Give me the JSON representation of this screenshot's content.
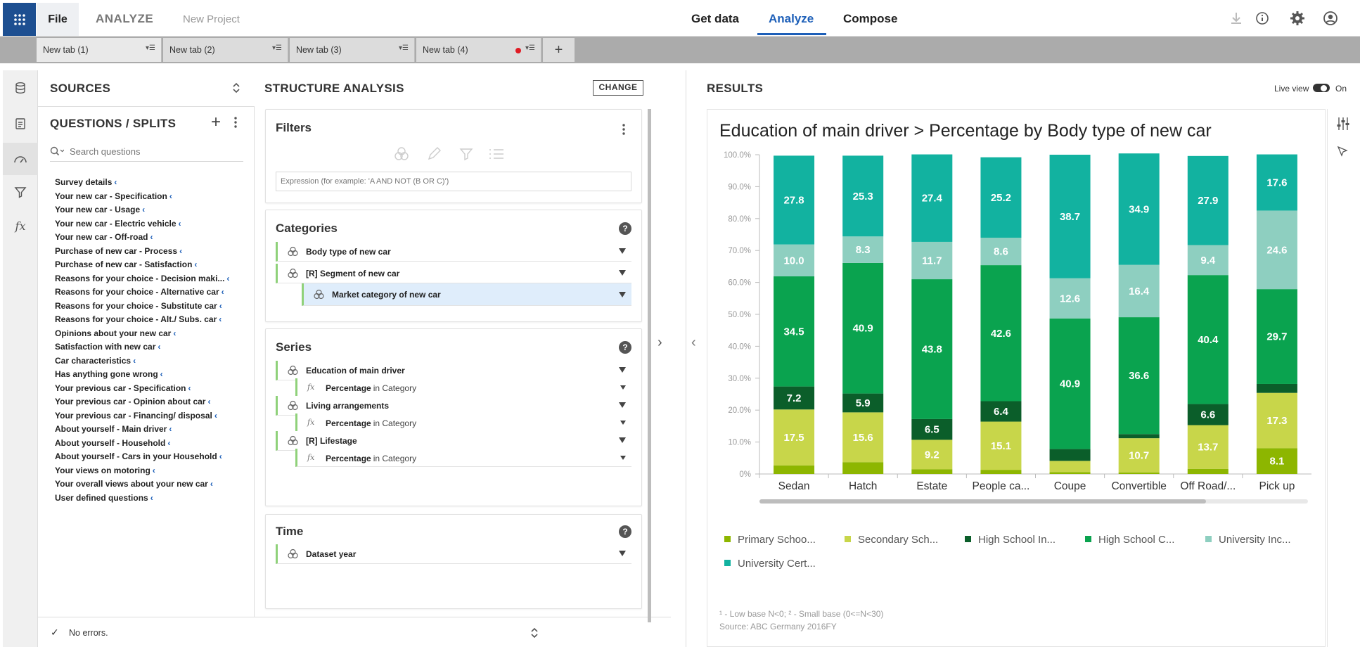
{
  "header": {
    "file_label": "File",
    "module_label": "ANALYZE",
    "project_name": "New Project",
    "nav_tabs": [
      "Get data",
      "Analyze",
      "Compose"
    ],
    "active_nav": "Analyze"
  },
  "doc_tabs": [
    {
      "label": "New tab (1)",
      "menu": "▾☰"
    },
    {
      "label": "New tab (2)",
      "menu": "▾☰"
    },
    {
      "label": "New tab (3)",
      "menu": "▾☰"
    },
    {
      "label": "New tab (4)",
      "menu": "▾☰",
      "modified": true
    }
  ],
  "new_tab_label": "+",
  "sources": {
    "title": "SOURCES"
  },
  "questions": {
    "title": "QUESTIONS / SPLITS",
    "search_placeholder": "Search questions",
    "items": [
      "Survey details",
      "Your new car - Specification",
      "Your new car - Usage",
      "Your new car - Electric vehicle",
      "Your new car - Off-road",
      "Purchase of new car - Process",
      "Purchase of new car - Satisfaction",
      "Reasons for your choice - Decision maki...",
      "Reasons for your choice - Alternative car",
      "Reasons for your choice - Substitute car",
      "Reasons for your choice - Alt./ Subs. car",
      "Opinions about your new car",
      "Satisfaction with new car",
      "Car characteristics",
      "Has anything gone wrong",
      "Your previous car - Specification",
      "Your previous car - Opinion about car",
      "Your previous car - Financing/ disposal",
      "About yourself - Main driver",
      "About yourself - Household",
      "About yourself - Cars in your Household",
      "Your views on motoring",
      "Your overall views about your new car",
      "User defined questions"
    ]
  },
  "status": {
    "text": "No errors."
  },
  "structure": {
    "title": "STRUCTURE ANALYSIS",
    "change_label": "CHANGE",
    "filters": {
      "title": "Filters",
      "placeholder": "Expression (for example: 'A AND NOT (B OR C)')"
    },
    "categories": {
      "title": "Categories",
      "rows": [
        "Body type of new car",
        "[R] Segment of new car",
        "Market category of new car"
      ]
    },
    "series": {
      "title": "Series",
      "rows": [
        {
          "label": "Education of main driver",
          "sub_label": "Percentage",
          "sub_suffix": "in Category"
        },
        {
          "label": "Living arrangements",
          "sub_label": "Percentage",
          "sub_suffix": "in Category"
        },
        {
          "label": "[R] Lifestage",
          "sub_label": "Percentage",
          "sub_suffix": "in Category"
        }
      ]
    },
    "time": {
      "title": "Time",
      "rows": [
        "Dataset year"
      ]
    },
    "help_label": "?"
  },
  "results": {
    "title": "RESULTS",
    "live_view_label": "Live view",
    "live_view_state": "On"
  },
  "chart_data": {
    "type": "bar",
    "stacked": true,
    "title": "Education of main driver > Percentage by Body type of new car",
    "categories": [
      "Sedan",
      "Hatch",
      "Estate",
      "People ca...",
      "Coupe",
      "Convertible",
      "Off Road/...",
      "Pick up"
    ],
    "y_ticks": [
      "0%",
      "10.0%",
      "20.0%",
      "30.0%",
      "40.0%",
      "50.0%",
      "60.0%",
      "70.0%",
      "80.0%",
      "90.0%",
      "100.0%"
    ],
    "ylim": [
      0,
      100
    ],
    "series": [
      {
        "name": "Primary Schoo...",
        "color": "#8db600",
        "values": [
          2.7,
          3.7,
          1.5,
          1.3,
          0.6,
          0.5,
          1.6,
          8.1
        ]
      },
      {
        "name": "Secondary Sch...",
        "color": "#c8d64a",
        "values": [
          17.5,
          15.6,
          9.2,
          15.1,
          3.5,
          10.7,
          13.7,
          17.3
        ]
      },
      {
        "name": "High School In...",
        "color": "#0b5e2a",
        "values": [
          7.2,
          5.9,
          6.5,
          6.4,
          3.7,
          1.3,
          6.6,
          2.8
        ]
      },
      {
        "name": "High School C...",
        "color": "#0aa34f",
        "values": [
          34.5,
          40.9,
          43.8,
          42.6,
          40.9,
          36.6,
          40.4,
          29.7
        ]
      },
      {
        "name": "University Inc...",
        "color": "#8ecfc0",
        "values": [
          10.0,
          8.3,
          11.7,
          8.6,
          12.6,
          16.4,
          9.4,
          24.6
        ]
      },
      {
        "name": "University Cert...",
        "color": "#12b2a0",
        "values": [
          27.8,
          25.3,
          27.4,
          25.2,
          38.7,
          34.9,
          27.9,
          17.6
        ]
      }
    ],
    "data_labels": [
      [
        null,
        null,
        null,
        null,
        null,
        null,
        null,
        "8.1"
      ],
      [
        "17.5",
        "15.6",
        "9.2",
        "15.1",
        null,
        "10.7",
        "13.7",
        "17.3"
      ],
      [
        "7.2",
        "5.9",
        "6.5",
        "6.4",
        null,
        null,
        "6.6",
        null
      ],
      [
        "34.5",
        "40.9",
        "43.8",
        "42.6",
        "40.9",
        "36.6",
        "40.4",
        "29.7"
      ],
      [
        "10.0",
        "8.3",
        "11.7",
        "8.6",
        "12.6",
        "16.4",
        "9.4",
        "24.6"
      ],
      [
        "27.8",
        "25.3",
        "27.4",
        "25.2",
        "38.7",
        "34.9",
        "27.9",
        "17.6"
      ]
    ],
    "legend_position": "bottom",
    "grid": false
  },
  "footnotes": {
    "bases": "¹ - Low base N<0;   ² - Small base (0<=N<30)",
    "source": "Source: ABC Germany 2016FY"
  }
}
